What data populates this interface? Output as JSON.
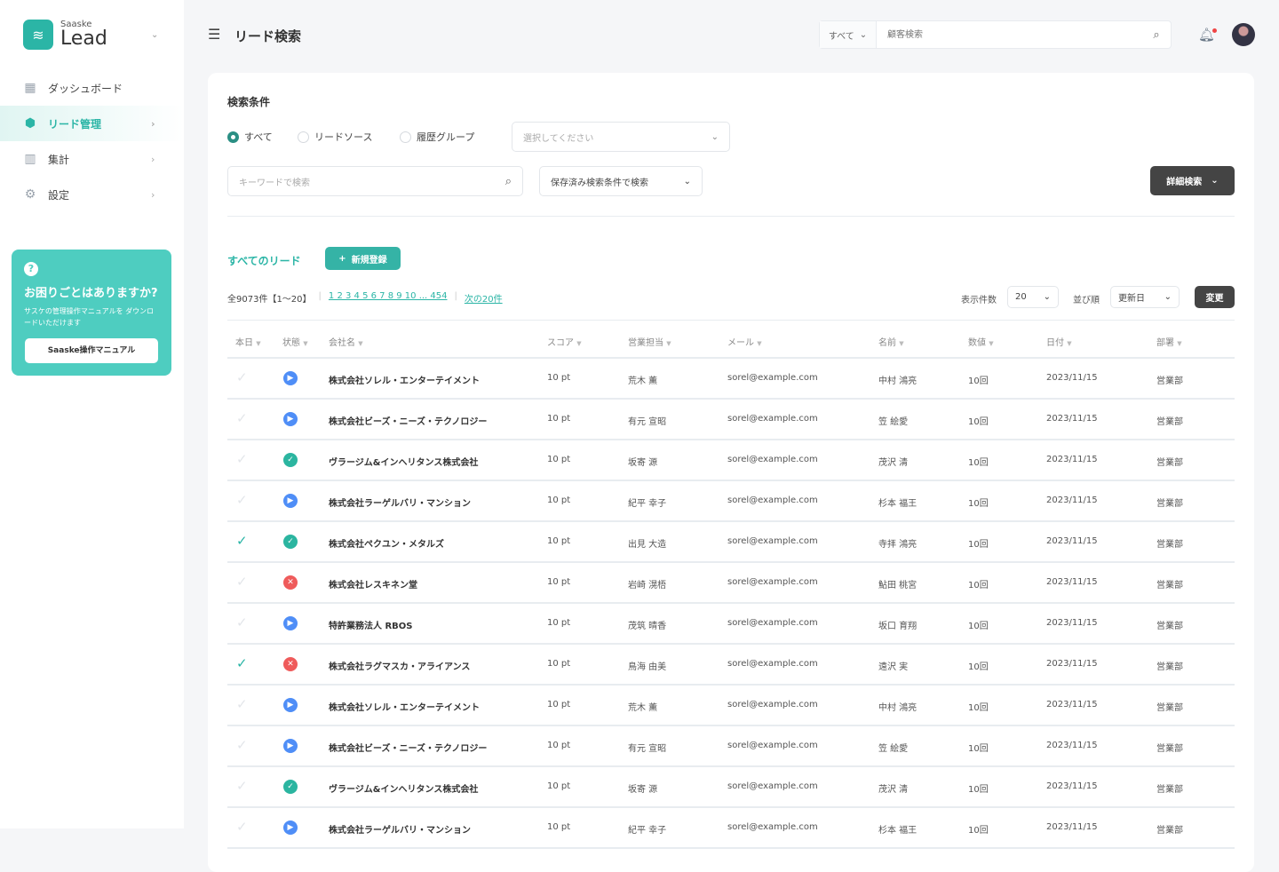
{
  "sidebar": {
    "logo_small": "Saaske",
    "logo_big": "Lead",
    "items": [
      {
        "label": "ダッシュボード",
        "icon": "grid-icon"
      },
      {
        "label": "リード管理",
        "icon": "cube-icon"
      },
      {
        "label": "集計",
        "icon": "bar-chart-icon"
      },
      {
        "label": "設定",
        "icon": "gear-icon"
      }
    ],
    "help": {
      "title": "お困りごとはありますか?",
      "text": "サスケの管理操作マニュアルを ダウンロードいただけます",
      "button": "Saaske操作マニュアル"
    }
  },
  "header": {
    "title": "リード検索",
    "search_category": "すべて",
    "search_placeholder": "顧客検索"
  },
  "search": {
    "title": "検索条件",
    "radios": [
      "すべて",
      "リードソース",
      "履歴グループ"
    ],
    "select_placeholder": "選択してください",
    "keyword_placeholder": "キーワードで検索",
    "saved_search": "保存済み検索条件で検索",
    "advanced": "詳細検索"
  },
  "list": {
    "title": "すべてのリード",
    "new_button": "新規登録",
    "count": "全9073件【1～20】",
    "pages": "1 2 3 4 5 6 7 8 9 10 ... 454",
    "next": "次の20件",
    "per_page_label": "表示件数",
    "per_page": "20",
    "sort_label": "並び順",
    "sort": "更新日",
    "apply": "変更"
  },
  "columns": [
    "本日",
    "状態",
    "会社名",
    "スコア",
    "営業担当",
    "メール",
    "名前",
    "数値",
    "日付",
    "部署"
  ],
  "status_colors": {
    "play": "#4f8ef7",
    "check": "#2bb5a0",
    "x": "#ef5b5b"
  },
  "rows": [
    {
      "today": false,
      "status": "play",
      "company": "株式会社ソレル・エンターテイメント",
      "score": "10 pt",
      "rep": "荒木 薫",
      "email": "sorel@example.com",
      "name": "中村 鴻亮",
      "count": "10回",
      "date": "2023/11/15",
      "dept": "営業部"
    },
    {
      "today": false,
      "status": "play",
      "company": "株式会社ビーズ・ニーズ・テクノロジー",
      "score": "10 pt",
      "rep": "有元 宣昭",
      "email": "sorel@example.com",
      "name": "笠 絵愛",
      "count": "10回",
      "date": "2023/11/15",
      "dept": "営業部"
    },
    {
      "today": false,
      "status": "check",
      "company": "ヴラージム&インヘリタンス株式会社",
      "score": "10 pt",
      "rep": "坂寄 源",
      "email": "sorel@example.com",
      "name": "茂沢 清",
      "count": "10回",
      "date": "2023/11/15",
      "dept": "営業部"
    },
    {
      "today": false,
      "status": "play",
      "company": "株式会社ラーゲルバリ・マンション",
      "score": "10 pt",
      "rep": "紀平 幸子",
      "email": "sorel@example.com",
      "name": "杉本 福王",
      "count": "10回",
      "date": "2023/11/15",
      "dept": "営業部"
    },
    {
      "today": true,
      "status": "check",
      "company": "株式会社ペクユン・メタルズ",
      "score": "10 pt",
      "rep": "出見 大造",
      "email": "sorel@example.com",
      "name": "寺拝 鴻亮",
      "count": "10回",
      "date": "2023/11/15",
      "dept": "営業部"
    },
    {
      "today": false,
      "status": "x",
      "company": "株式会社レスキネン堂",
      "score": "10 pt",
      "rep": "岩崎 滉梧",
      "email": "sorel@example.com",
      "name": "鮎田 桃宮",
      "count": "10回",
      "date": "2023/11/15",
      "dept": "営業部"
    },
    {
      "today": false,
      "status": "play",
      "company": "特許業務法人 RBOS",
      "score": "10 pt",
      "rep": "茂筑 晴香",
      "email": "sorel@example.com",
      "name": "坂口 育翔",
      "count": "10回",
      "date": "2023/11/15",
      "dept": "営業部"
    },
    {
      "today": true,
      "status": "x",
      "company": "株式会社ラグマスカ・アライアンス",
      "score": "10 pt",
      "rep": "鳥海 由美",
      "email": "sorel@example.com",
      "name": "遠沢 実",
      "count": "10回",
      "date": "2023/11/15",
      "dept": "営業部"
    },
    {
      "today": false,
      "status": "play",
      "company": "株式会社ソレル・エンターテイメント",
      "score": "10 pt",
      "rep": "荒木 薫",
      "email": "sorel@example.com",
      "name": "中村 鴻亮",
      "count": "10回",
      "date": "2023/11/15",
      "dept": "営業部"
    },
    {
      "today": false,
      "status": "play",
      "company": "株式会社ビーズ・ニーズ・テクノロジー",
      "score": "10 pt",
      "rep": "有元 宣昭",
      "email": "sorel@example.com",
      "name": "笠 絵愛",
      "count": "10回",
      "date": "2023/11/15",
      "dept": "営業部"
    },
    {
      "today": false,
      "status": "check",
      "company": "ヴラージム&インヘリタンス株式会社",
      "score": "10 pt",
      "rep": "坂寄 源",
      "email": "sorel@example.com",
      "name": "茂沢 清",
      "count": "10回",
      "date": "2023/11/15",
      "dept": "営業部"
    },
    {
      "today": false,
      "status": "play",
      "company": "株式会社ラーゲルバリ・マンション",
      "score": "10 pt",
      "rep": "紀平 幸子",
      "email": "sorel@example.com",
      "name": "杉本 福王",
      "count": "10回",
      "date": "2023/11/15",
      "dept": "営業部"
    }
  ]
}
